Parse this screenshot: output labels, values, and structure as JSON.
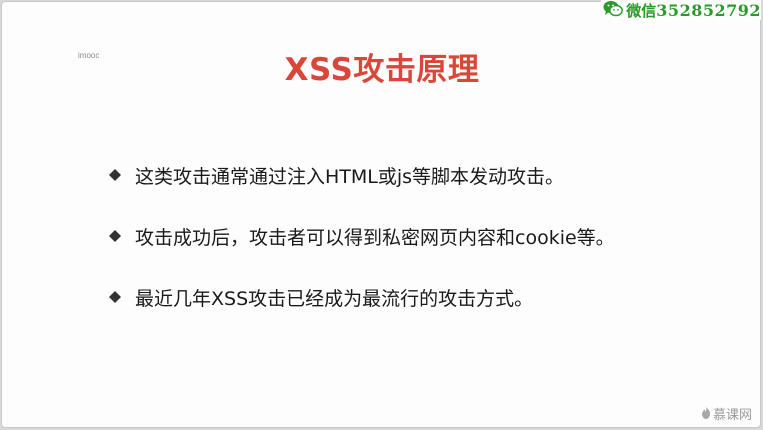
{
  "slide": {
    "watermark_small": "imooc",
    "title": "XSS攻击原理",
    "bullets": [
      "这类攻击通常通过注入HTML或js等脚本发动攻击。",
      "攻击成功后，攻击者可以得到私密网页内容和cookie等。",
      "最近几年XSS攻击已经成为最流行的攻击方式。"
    ]
  },
  "overlay": {
    "wechat_label": "微信",
    "wechat_number": "352852792",
    "logo_text": "慕课网"
  },
  "colors": {
    "title": "#d9473a",
    "wechat": "#2a9a2a",
    "bullet_marker": "#333333"
  }
}
